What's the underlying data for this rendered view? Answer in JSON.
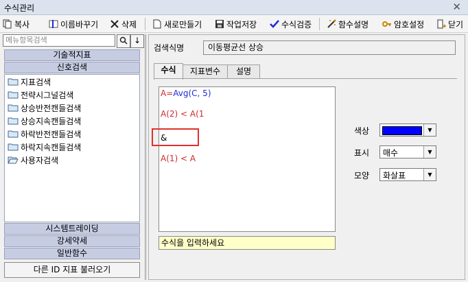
{
  "window": {
    "title": "수식관리",
    "close_glyph": "✕"
  },
  "toolbar": {
    "copy": "복사",
    "rename": "이름바꾸기",
    "delete": "삭제",
    "new": "새로만들기",
    "save": "작업저장",
    "verify": "수식검증",
    "func_help": "함수설명",
    "password": "암호설정",
    "close": "닫기"
  },
  "sidebar": {
    "search_placeholder": "메뉴항목검색",
    "search_button": "🔍",
    "sort_button": "↓",
    "categories_top": [
      "기술적지표",
      "신호검색"
    ],
    "tree_items": [
      "지표검색",
      "전략시그널검색",
      "상승반전캔들검색",
      "상승지속캔들검색",
      "하락반전캔들검색",
      "하락지속캔들검색",
      "사용자검색"
    ],
    "categories_bottom": [
      "시스템트레이딩",
      "강세약세",
      "일반함수"
    ],
    "load_button": "다른 ID 지표 불러오기"
  },
  "editor": {
    "name_label": "검색식명",
    "name_value": "이동평균선 상승",
    "tabs": [
      "수식",
      "지표변수",
      "설명"
    ],
    "active_tab": "수식",
    "lines": [
      {
        "prefix": "A=",
        "rest": "Avg(C, 5)"
      },
      {
        "prefix": "",
        "rest": "A(2) < A(1"
      },
      {
        "prefix": "",
        "rest": "&"
      },
      {
        "prefix": "",
        "rest": "A(1) < A"
      }
    ],
    "hint": "수식을 입력하세요"
  },
  "properties": {
    "color_label": "색상",
    "color_value": "#0000ff",
    "display_label": "표시",
    "display_value": "매수",
    "shape_label": "모양",
    "shape_value": "화살표"
  },
  "colors": {
    "formula_red": "#cc2a2a",
    "formula_blue": "#1d2bd8",
    "highlight": "#e0302a"
  }
}
